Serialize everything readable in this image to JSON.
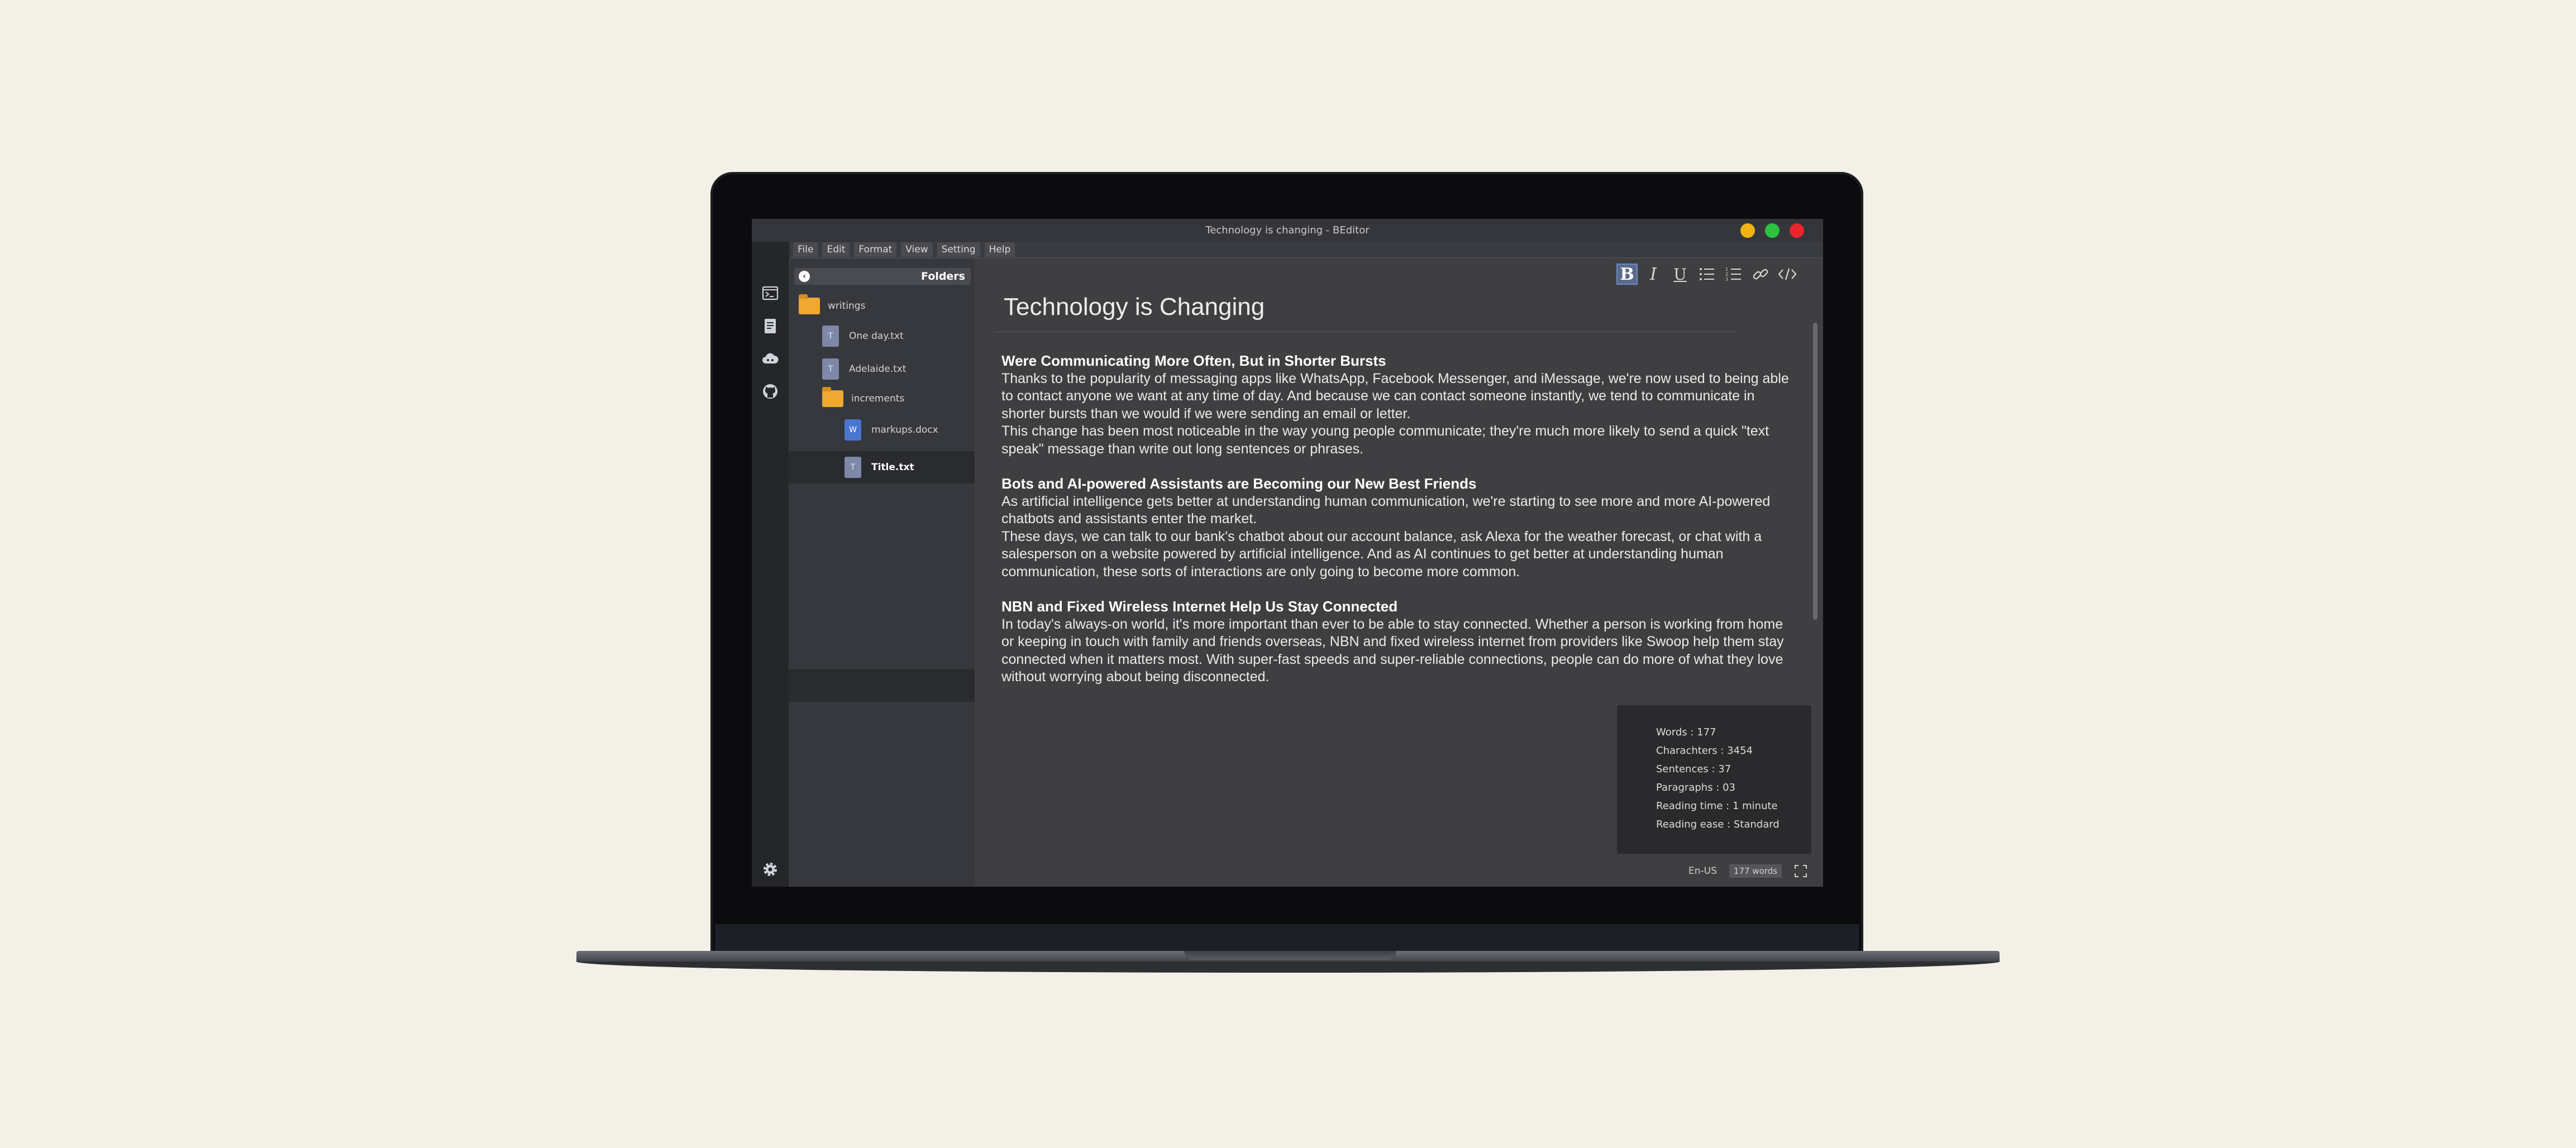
{
  "window": {
    "title": "Technology is changing - BEditor",
    "colors": {
      "minimize": "#f2b213",
      "maximize": "#2dc23f",
      "close": "#e8242c"
    }
  },
  "menu": [
    "File",
    "Edit",
    "Format",
    "View",
    "Setting",
    "Help"
  ],
  "rail_icons": [
    "terminal-icon",
    "notes-icon",
    "cloud-icon",
    "github-icon",
    "settings-icon"
  ],
  "folders": {
    "title": "Folders",
    "items": [
      {
        "label": "writings",
        "type": "folder"
      },
      {
        "label": "One day.txt",
        "type": "txt",
        "badge": "T"
      },
      {
        "label": "Adelaide.txt",
        "type": "txt",
        "badge": "T"
      },
      {
        "label": "increments",
        "type": "folder"
      },
      {
        "label": "markups.docx",
        "type": "docx",
        "badge": "W"
      },
      {
        "label": "Title.txt",
        "type": "txt",
        "badge": "T",
        "selected": true
      }
    ]
  },
  "toolbar": [
    "bold-icon",
    "italic-icon",
    "underline-icon",
    "bullet-list-icon",
    "numbered-list-icon",
    "link-icon",
    "code-icon"
  ],
  "document": {
    "title": "Technology is Changing",
    "sections": [
      {
        "heading": "Were Communicating More Often, But in Shorter Bursts",
        "paragraphs": [
          "Thanks to the popularity of messaging apps like WhatsApp, Facebook Messenger, and iMessage, we're now used to being able to contact anyone we want at any time of day. And because we can contact someone instantly, we tend to communicate in shorter bursts than we would if we were sending an email or letter.",
          "This change has been most noticeable in the way young people communicate; they're much more likely to send a quick \"text speak\" message than write out long sentences or phrases."
        ]
      },
      {
        "heading": "Bots and AI-powered Assistants are Becoming our New Best Friends",
        "paragraphs": [
          "As artificial intelligence gets better at understanding human communication, we're starting to see more and more AI-powered chatbots and assistants enter the market.",
          "These days, we can talk to our bank's chatbot about our account balance, ask Alexa for the weather forecast, or chat with a salesperson on a website powered by artificial intelligence. And as AI continues to get better at understanding human communication, these sorts of interactions are only going to become more common."
        ]
      },
      {
        "heading": "NBN and Fixed Wireless Internet Help Us Stay Connected",
        "paragraphs": [
          "In today's always-on world, it's more important than ever to be able to stay connected. Whether a person is working from home or keeping in touch with family and friends overseas, NBN and fixed wireless internet from providers like Swoop help them stay connected when it matters most. With super-fast speeds and super-reliable connections, people can do more of what they love without worrying about being disconnected."
        ]
      }
    ]
  },
  "stats": [
    "Words : 177",
    "Charachters : 3454",
    "Sentences : 37",
    "Paragraphs : 03",
    "Reading time : 1 minute",
    "Reading ease : Standard"
  ],
  "status": {
    "language": "En-US",
    "word_count": "177 words"
  }
}
